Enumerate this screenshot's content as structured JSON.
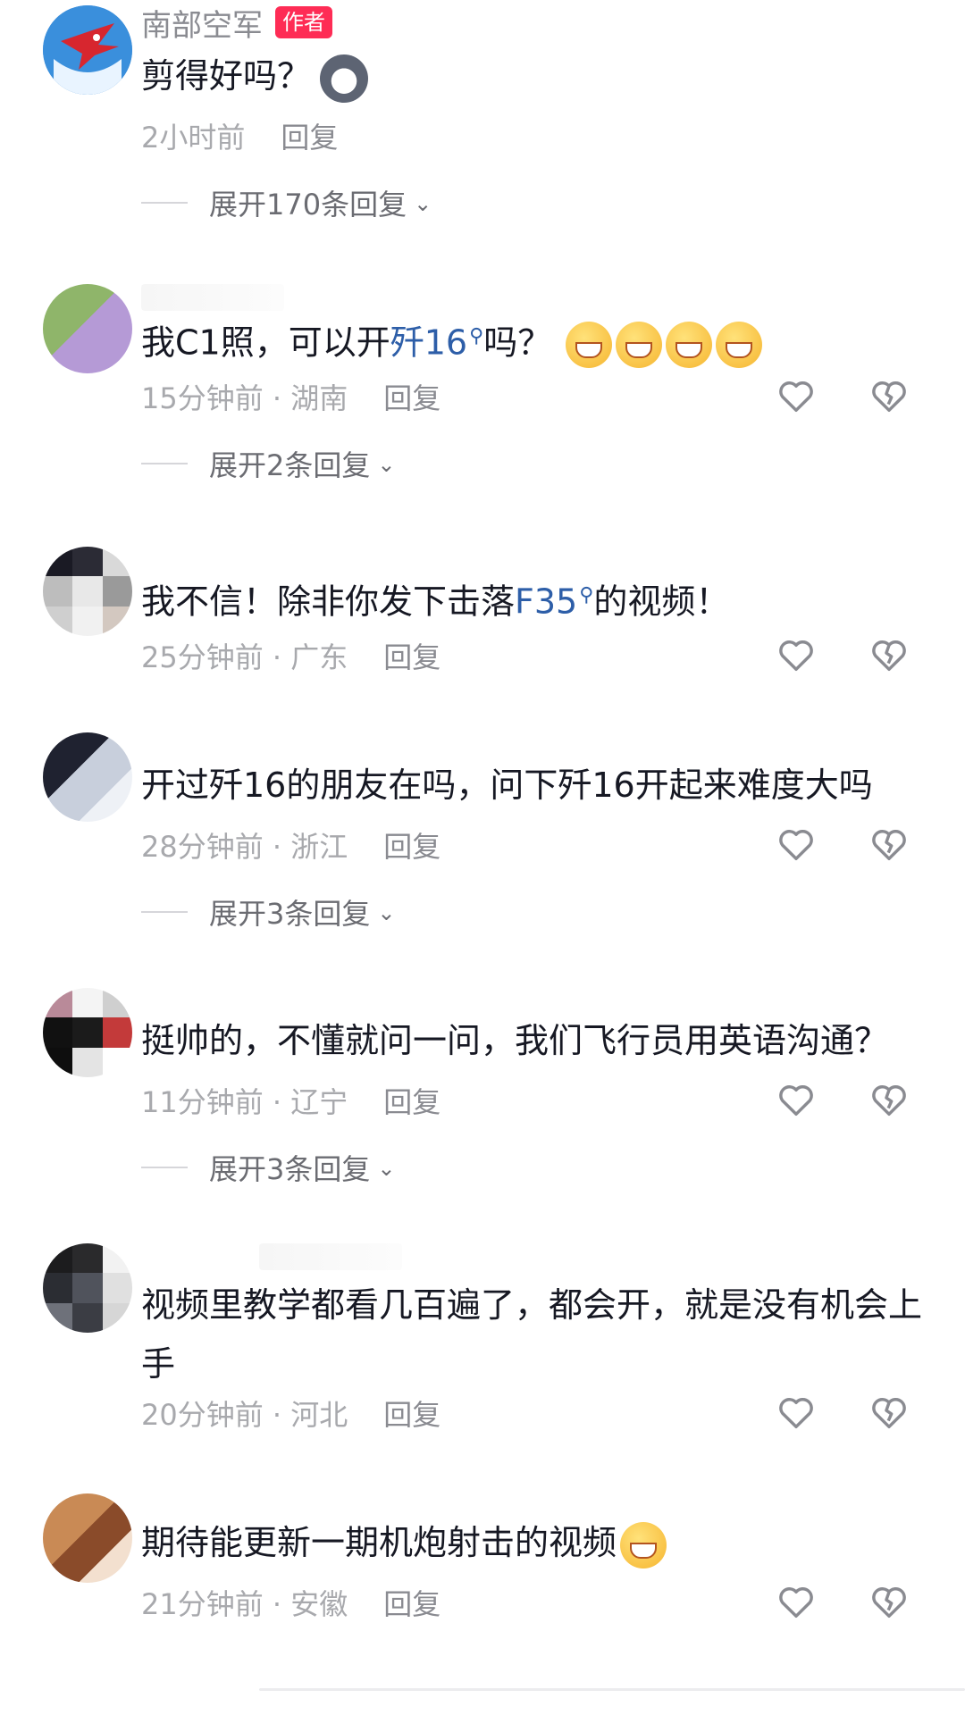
{
  "comments": [
    {
      "author": "南部空军",
      "badge": "作者",
      "text": "剪得好吗？",
      "time": "2小时前",
      "location": "",
      "reply_label": "回复",
      "expand": "展开170条回复"
    },
    {
      "text_parts": [
        "我C1照，可以开",
        "歼16",
        "吗？"
      ],
      "time": "15分钟前 · 湖南",
      "reply_label": "回复",
      "expand": "展开2条回复"
    },
    {
      "text_parts": [
        "我不信！除非你发下击落",
        "F35",
        "的视频！"
      ],
      "time": "25分钟前 · 广东",
      "reply_label": "回复"
    },
    {
      "text": "开过歼16的朋友在吗，问下歼16开起来难度大吗",
      "time": "28分钟前 · 浙江",
      "reply_label": "回复",
      "expand": "展开3条回复"
    },
    {
      "text": "挺帅的，不懂就问一问，我们飞行员用英语沟通？",
      "time": "11分钟前 · 辽宁",
      "reply_label": "回复",
      "expand": "展开3条回复"
    },
    {
      "text": "视频里教学都看几百遍了，都会开，就是没有机会上手",
      "time": "20分钟前 · 河北",
      "reply_label": "回复"
    },
    {
      "text": "期待能更新一期机炮射击的视频",
      "time": "21分钟前 · 安徽",
      "reply_label": "回复"
    }
  ],
  "colors": {
    "text": "#161823",
    "muted": "#a8a9ad",
    "tag": "#2d5ea8",
    "badge": "#fe2c55"
  },
  "icons": [
    "heart-icon",
    "broken-heart-icon",
    "chevron-down-icon",
    "search-icon"
  ]
}
